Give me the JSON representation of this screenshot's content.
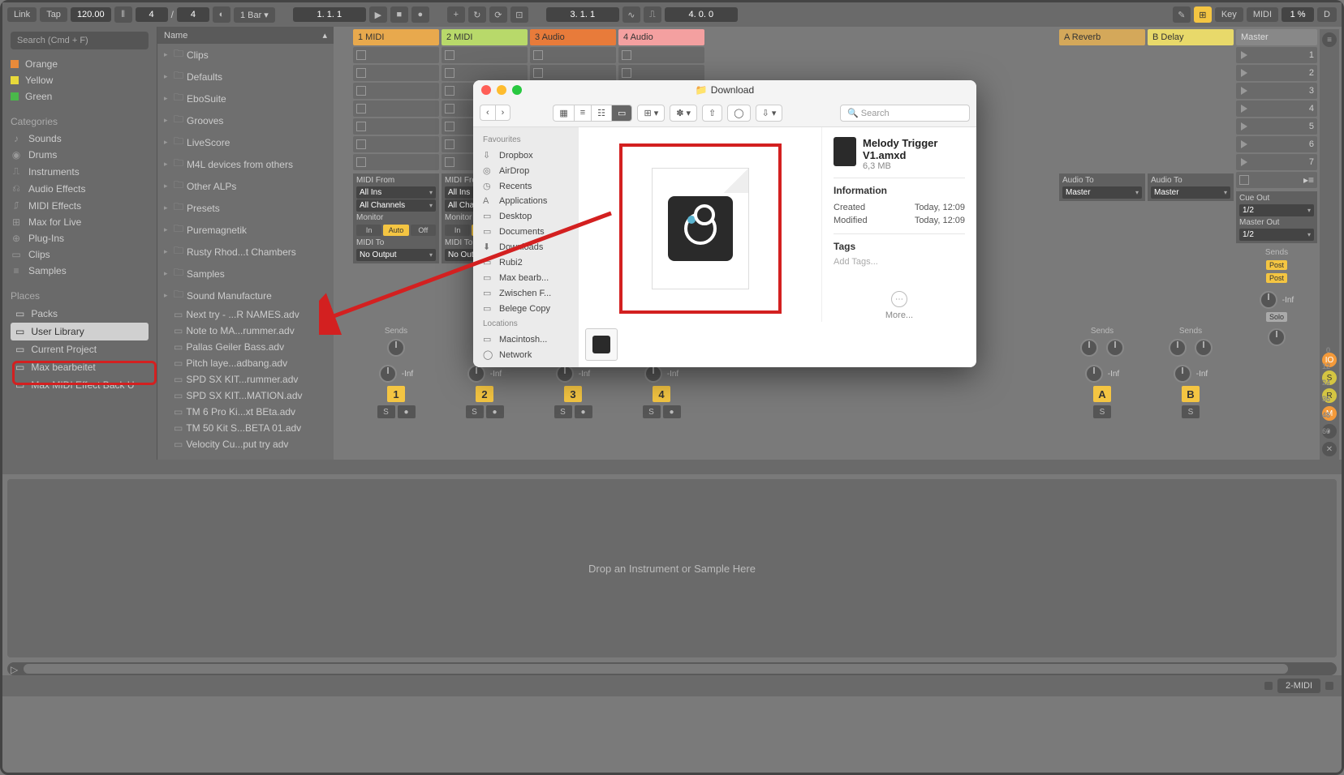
{
  "toolbar": {
    "link": "Link",
    "tap": "Tap",
    "tempo": "120.00",
    "sig_num": "4",
    "sig_den": "4",
    "bar": "1 Bar",
    "position": "1.  1.  1",
    "arr_pos": "3.  1.  1",
    "loop_len": "4.  0.  0",
    "key": "Key",
    "midi": "MIDI",
    "pct": "1 %",
    "d": "D"
  },
  "search_placeholder": "Search (Cmd + F)",
  "collections": [
    {
      "color": "#e88a3a",
      "label": "Orange"
    },
    {
      "color": "#e8d93a",
      "label": "Yellow"
    },
    {
      "color": "#4ab84a",
      "label": "Green"
    }
  ],
  "categories_h": "Categories",
  "categories": [
    {
      "icon": "♪",
      "label": "Sounds"
    },
    {
      "icon": "◉",
      "label": "Drums"
    },
    {
      "icon": "⎍",
      "label": "Instruments"
    },
    {
      "icon": "⎌",
      "label": "Audio Effects"
    },
    {
      "icon": "⎎",
      "label": "MIDI Effects"
    },
    {
      "icon": "⊞",
      "label": "Max for Live"
    },
    {
      "icon": "⊕",
      "label": "Plug-Ins"
    },
    {
      "icon": "▭",
      "label": "Clips"
    },
    {
      "icon": "≡",
      "label": "Samples"
    }
  ],
  "places_h": "Places",
  "places": [
    {
      "label": "Packs",
      "selected": false
    },
    {
      "label": "User Library",
      "selected": true
    },
    {
      "label": "Current Project",
      "selected": false
    },
    {
      "label": "Max bearbeitet",
      "selected": false
    },
    {
      "label": "Max MIDI Effect Back U",
      "selected": false
    }
  ],
  "browser_head": "Name",
  "browser_items": [
    {
      "t": "folder",
      "label": "Clips"
    },
    {
      "t": "folder",
      "label": "Defaults"
    },
    {
      "t": "folder",
      "label": "EboSuite"
    },
    {
      "t": "folder",
      "label": "Grooves"
    },
    {
      "t": "folder",
      "label": "LiveScore"
    },
    {
      "t": "folder",
      "label": "M4L devices from others"
    },
    {
      "t": "folder",
      "label": "Other ALPs"
    },
    {
      "t": "folder",
      "label": "Presets"
    },
    {
      "t": "folder",
      "label": "Puremagnetik"
    },
    {
      "t": "folder",
      "label": "Rusty Rhod...t Chambers"
    },
    {
      "t": "folder",
      "label": "Samples"
    },
    {
      "t": "folder",
      "label": "Sound Manufacture"
    },
    {
      "t": "file",
      "label": "Next try - ...R NAMES.adv"
    },
    {
      "t": "file",
      "label": "Note to MA...rummer.adv"
    },
    {
      "t": "file",
      "label": "Pallas  Geiler Bass.adv"
    },
    {
      "t": "file",
      "label": "Pitch laye...adbang.adv"
    },
    {
      "t": "file",
      "label": "SPD SX KIT...rummer.adv"
    },
    {
      "t": "file",
      "label": "SPD SX KIT...MATION.adv"
    },
    {
      "t": "file",
      "label": "TM 6 Pro Ki...xt BEta.adv"
    },
    {
      "t": "file",
      "label": "TM 50 Kit S...BETA 01.adv"
    },
    {
      "t": "file",
      "label": "Velocity Cu...put try adv"
    }
  ],
  "tracks": [
    {
      "name": "1 MIDI",
      "cls": "t1",
      "num": "1"
    },
    {
      "name": "2 MIDI",
      "cls": "t2",
      "num": "2"
    },
    {
      "name": "3 Audio",
      "cls": "t3",
      "num": "3"
    },
    {
      "name": "4 Audio",
      "cls": "t4",
      "num": "4"
    }
  ],
  "returns": [
    {
      "name": "A Reverb",
      "cls": "trev",
      "num": "A"
    },
    {
      "name": "B Delay",
      "cls": "tdel",
      "num": "B"
    }
  ],
  "master": {
    "name": "Master",
    "cls": "tmas"
  },
  "master_slots": [
    "1",
    "2",
    "3",
    "4",
    "5",
    "6",
    "7"
  ],
  "io": {
    "midi_from": "MIDI From",
    "all_ins": "All Ins",
    "all_ch": "All Channels",
    "monitor": "Monitor",
    "in": "In",
    "auto": "Auto",
    "off": "Off",
    "midi_to": "MIDI To",
    "no_output": "No Output",
    "audio_to": "Audio To",
    "master_opt": "Master",
    "sends": "Sends",
    "cue_out": "Cue Out",
    "half": "1/2",
    "master_out": "Master Out",
    "post": "Post",
    "solo": "Solo",
    "inf": "-Inf",
    "s": "S",
    "rec": "●"
  },
  "scale": [
    "0",
    "12",
    "24",
    "36",
    "48",
    "60"
  ],
  "drop_text": "Drop an Instrument or Sample Here",
  "status": {
    "label": "2-MIDI"
  },
  "finder": {
    "title": "Download",
    "search_placeholder": "Search",
    "sidebar": {
      "favourites_h": "Favourites",
      "favourites": [
        {
          "icon": "⇩",
          "label": "Dropbox"
        },
        {
          "icon": "◎",
          "label": "AirDrop"
        },
        {
          "icon": "◷",
          "label": "Recents"
        },
        {
          "icon": "A",
          "label": "Applications"
        },
        {
          "icon": "▭",
          "label": "Desktop"
        },
        {
          "icon": "▭",
          "label": "Documents"
        },
        {
          "icon": "⬇",
          "label": "Downloads"
        },
        {
          "icon": "▭",
          "label": "Rubi2"
        },
        {
          "icon": "▭",
          "label": "Max bearb..."
        },
        {
          "icon": "▭",
          "label": "Zwischen F..."
        },
        {
          "icon": "▭",
          "label": "Belege Copy"
        }
      ],
      "locations_h": "Locations",
      "locations": [
        {
          "icon": "▭",
          "label": "Macintosh..."
        },
        {
          "icon": "◯",
          "label": "Network"
        }
      ]
    },
    "file": {
      "name": "Melody Trigger V1.amxd",
      "size": "6,3 MB",
      "info_h": "Information",
      "created_k": "Created",
      "created_v": "Today, 12:09",
      "modified_k": "Modified",
      "modified_v": "Today, 12:09",
      "tags_h": "Tags",
      "add_tags": "Add Tags...",
      "more": "More..."
    }
  }
}
